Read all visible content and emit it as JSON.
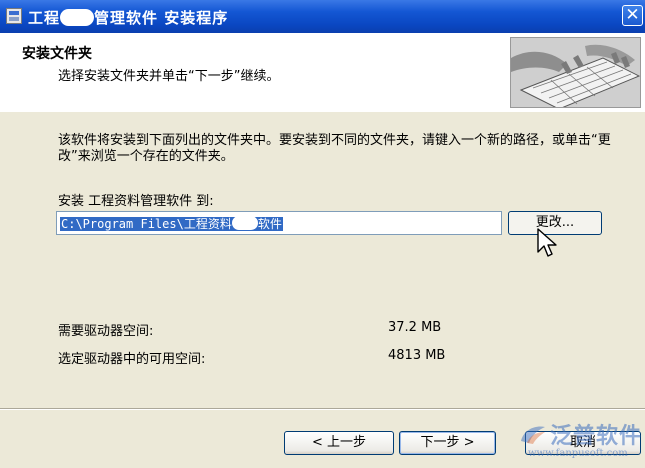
{
  "window": {
    "title_prefix": "工程",
    "title_suffix": "管理软件 安装程序",
    "close_glyph": "✕"
  },
  "header": {
    "title": "安装文件夹",
    "subtitle": "选择安装文件夹并单击“下一步”继续。"
  },
  "body": {
    "description": "该软件将安装到下面列出的文件夹中。要安装到不同的文件夹，请键入一个新的路径，或单击“更改”来浏览一个存在的文件夹。",
    "install_label": "安装 工程资料管理软件 到:",
    "path_prefix": "C:\\Program Files\\工程资料",
    "path_suffix": "软件",
    "change_button": "更改...",
    "space_required_label": "需要驱动器空间:",
    "space_required_value": "37.2 MB",
    "space_available_label": "选定驱动器中的可用空间:",
    "space_available_value": "4813 MB"
  },
  "footer": {
    "back_button": "< 上一步",
    "next_button": "下一步 >",
    "cancel_button": "取消"
  },
  "watermark": {
    "text": "泛普软件",
    "url": "www.fanpusoft.com"
  },
  "icons": [
    "installer-icon",
    "close-icon",
    "mouse-cursor-icon",
    "fanpu-logo-icon"
  ],
  "colors": {
    "titlebar": "#0a47c2",
    "selection": "#316ac5",
    "dialog_bg": "#ece9d8"
  }
}
